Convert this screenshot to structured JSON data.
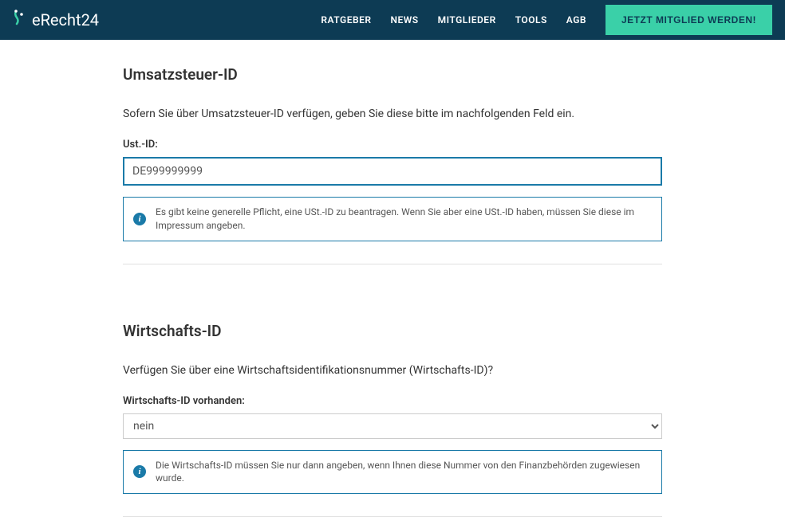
{
  "navbar": {
    "logoText": "eRecht24",
    "links": {
      "ratgeber": "RATGEBER",
      "news": "NEWS",
      "mitglieder": "MITGLIEDER",
      "tools": "TOOLS",
      "agb": "AGB"
    },
    "cta": "JETZT MITGLIED WERDEN!"
  },
  "section1": {
    "title": "Umsatzsteuer-ID",
    "desc": "Sofern Sie über Umsatzsteuer-ID verfügen, geben Sie diese bitte im nachfolgenden Feld ein.",
    "label": "Ust.-ID:",
    "value": "DE999999999",
    "infoText": "Es gibt keine generelle Pflicht, eine USt.-ID zu beantragen. Wenn Sie aber eine USt.-ID haben, müssen Sie diese im Impressum angeben."
  },
  "section2": {
    "title": "Wirtschafts-ID",
    "desc": "Verfügen Sie über eine Wirtschaftsidentifikationsnummer (Wirtschafts-ID)?",
    "label": "Wirtschafts-ID vorhanden:",
    "value": "nein",
    "infoText": "Die Wirtschafts-ID müssen Sie nur dann angeben, wenn Ihnen diese Nummer von den Finanzbehörden zugewiesen wurde."
  }
}
